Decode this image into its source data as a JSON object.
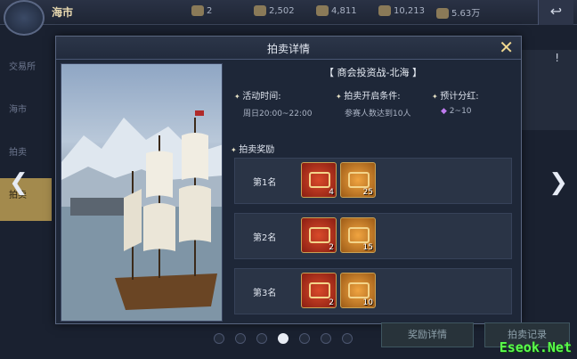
{
  "topbar": {
    "title": "海市",
    "resources": [
      {
        "icon": "shell-icon",
        "value": "2"
      },
      {
        "icon": "crystal-icon",
        "value": "2,502"
      },
      {
        "icon": "coin-stack-icon",
        "value": "4,811"
      },
      {
        "icon": "gold-icon",
        "value": "10,213"
      },
      {
        "icon": "silver-icon",
        "value": "5.63万"
      }
    ]
  },
  "side_tabs": [
    "交易所",
    "海市",
    "拍卖",
    "拍卖"
  ],
  "dialog": {
    "title": "拍卖详情",
    "event_title": "【 商会投资战-北海 】",
    "activity_time_label": "活动时间:",
    "activity_time_value": "周日20:00~22:00",
    "condition_label": "拍卖开启条件:",
    "condition_value": "参赛人数达到10人",
    "dividend_label": "预计分红:",
    "dividend_value": "2~10",
    "rewards_label": "拍卖奖励",
    "ranks": [
      {
        "label": "第1名",
        "items": [
          {
            "kind": "red",
            "count": "4"
          },
          {
            "kind": "gold",
            "count": "25"
          }
        ]
      },
      {
        "label": "第2名",
        "items": [
          {
            "kind": "red",
            "count": "2"
          },
          {
            "kind": "gold",
            "count": "15"
          }
        ]
      },
      {
        "label": "第3名",
        "items": [
          {
            "kind": "red",
            "count": "2"
          },
          {
            "kind": "gold",
            "count": "10"
          }
        ]
      }
    ]
  },
  "pagination": {
    "total": 7,
    "active": 3
  },
  "bottom": {
    "btn1": "奖励详情",
    "btn2": "拍卖记录"
  },
  "watermark": "Eseok.Net"
}
